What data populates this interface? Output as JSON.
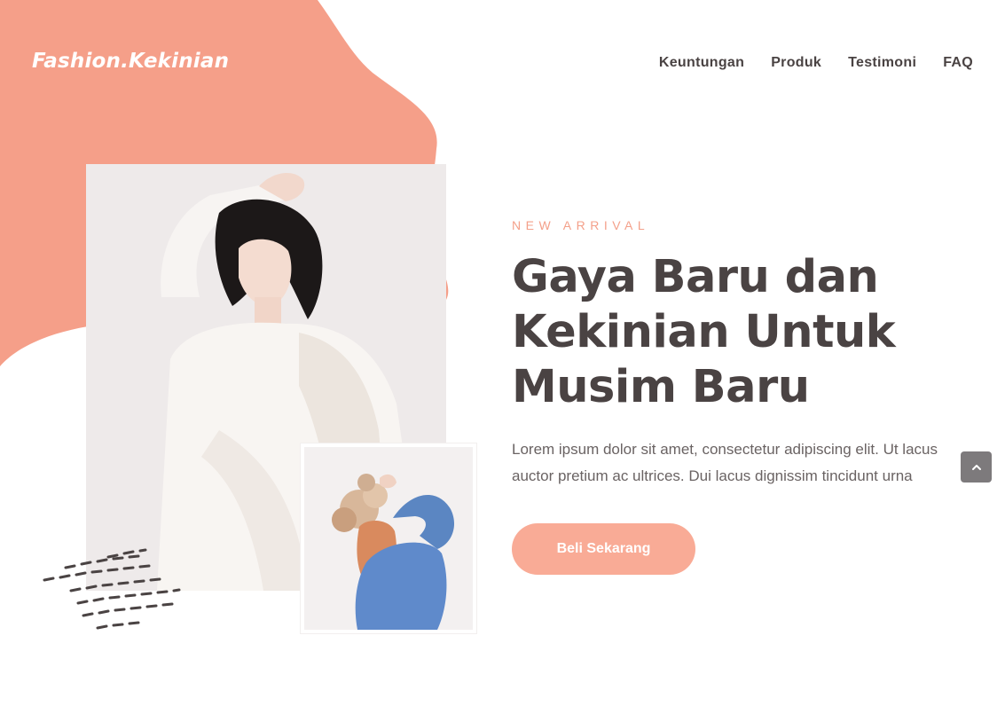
{
  "brand": {
    "logo_text": "Fashion.Kekinian",
    "accent_color": "#f59f89",
    "button_color": "#f9ab96",
    "text_color": "#4a4343"
  },
  "nav": {
    "items": [
      {
        "label": "Keuntungan"
      },
      {
        "label": "Produk"
      },
      {
        "label": "Testimoni"
      },
      {
        "label": "FAQ"
      }
    ]
  },
  "hero": {
    "eyebrow": "NEW ARRIVAL",
    "headline_lines": [
      "Gaya Baru dan",
      "Kekinian Untuk",
      "Musim Baru"
    ],
    "description": "Lorem ipsum dolor sit amet, consectetur adipiscing elit. Ut lacus auctor pretium ac ultrices. Dui lacus dignissim tincidunt urna",
    "cta_label": "Beli Sekarang"
  },
  "images": {
    "main_photo": "woman-in-white-dress-photo",
    "small_photo": "woman-with-dried-flowers-photo"
  },
  "scroll_top": {
    "icon": "chevron-up-icon"
  }
}
